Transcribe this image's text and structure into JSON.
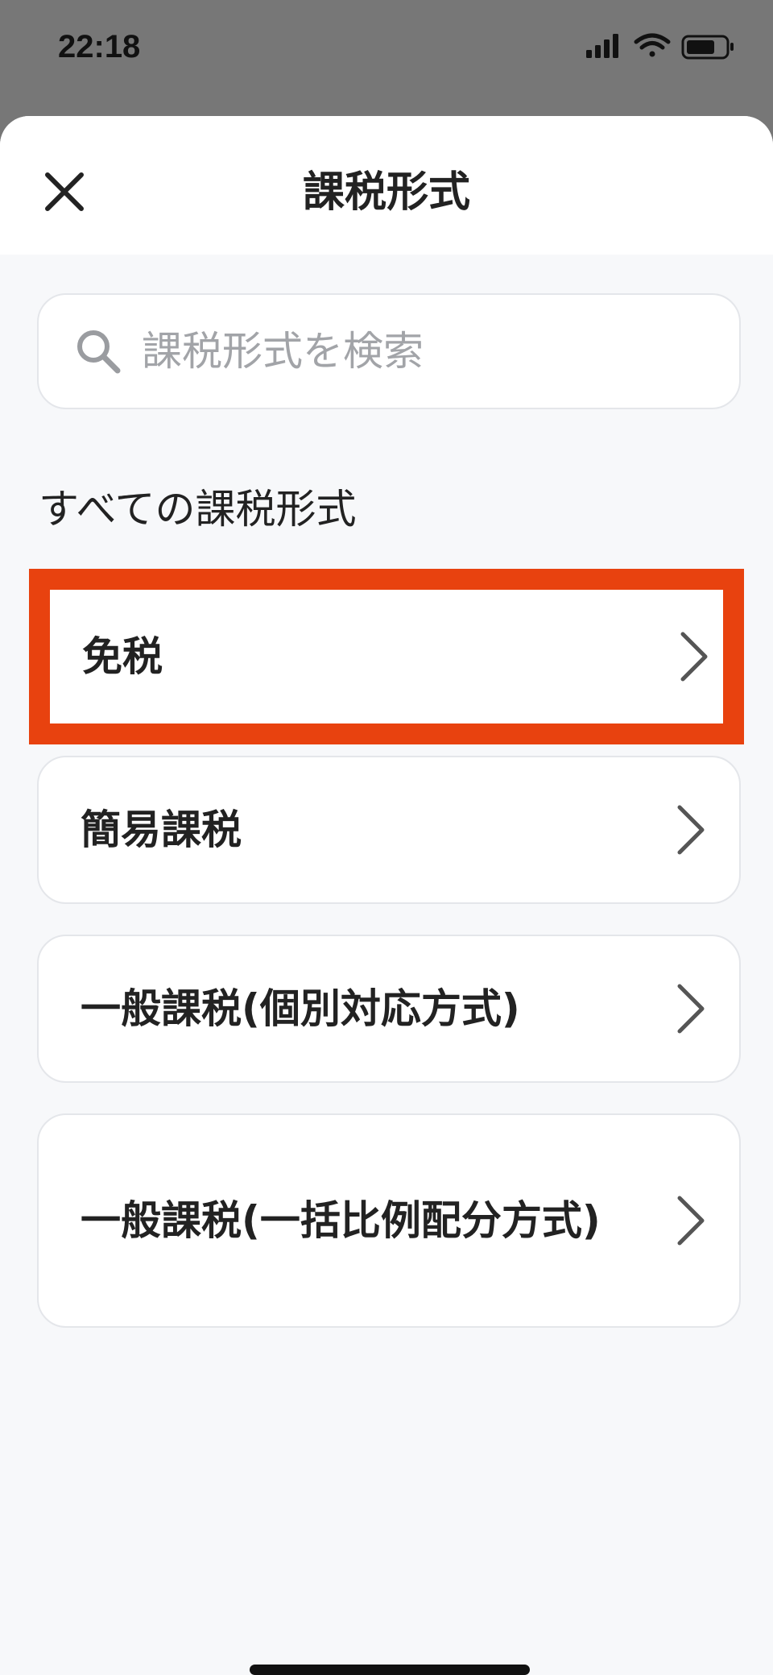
{
  "status_bar": {
    "time": "22:18",
    "icons": [
      "signal-icon",
      "wifi-icon",
      "battery-icon"
    ]
  },
  "sheet": {
    "title": "課税形式",
    "close_icon": "close-icon"
  },
  "search": {
    "placeholder": "課税形式を検索",
    "value": "",
    "icon": "search-icon"
  },
  "section": {
    "heading": "すべての課税形式"
  },
  "options": [
    {
      "label": "免税",
      "highlighted": true
    },
    {
      "label": "簡易課税",
      "highlighted": false
    },
    {
      "label": "一般課税(個別対応方式)",
      "highlighted": false
    },
    {
      "label": "一般課税(一括比例配分方式)",
      "highlighted": false
    }
  ],
  "colors": {
    "highlight": "#e8420f",
    "background": "#f7f8fa",
    "overlay": "#777777"
  }
}
